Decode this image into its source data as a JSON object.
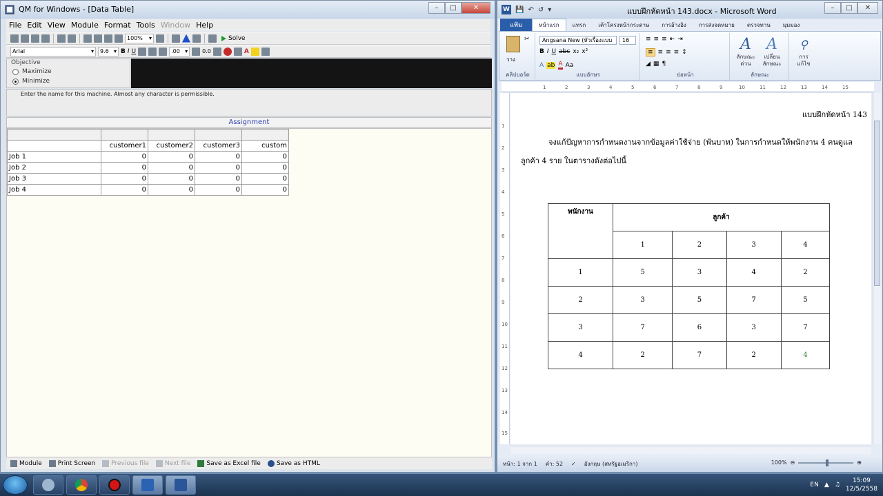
{
  "qm": {
    "title": "QM for Windows - [Data Table]",
    "menu": [
      "File",
      "Edit",
      "View",
      "Module",
      "Format",
      "Tools",
      "Window",
      "Help"
    ],
    "menu_disabled": "Window",
    "toolbar": {
      "zoom": "100%",
      "solve_label": "Solve"
    },
    "format_bar": {
      "font": "Arial",
      "size": "9.6",
      "decimals": ".00",
      "fixed": "0.0"
    },
    "objective": {
      "legend": "Objective",
      "maximize": "Maximize",
      "minimize": "Minimize",
      "selected": "minimize"
    },
    "instruction": "Enter the name for this machine. Almost any character is permissible.",
    "table_title": "Assignment",
    "columns": [
      "customer1",
      "customer2",
      "customer3",
      "custom"
    ],
    "rows": [
      {
        "label": "Job 1",
        "values": [
          "0",
          "0",
          "0",
          "0"
        ]
      },
      {
        "label": "Job 2",
        "values": [
          "0",
          "0",
          "0",
          "0"
        ]
      },
      {
        "label": "Job 3",
        "values": [
          "0",
          "0",
          "0",
          "0"
        ]
      },
      {
        "label": "Job 4",
        "values": [
          "0",
          "0",
          "0",
          "0"
        ]
      }
    ],
    "statusbar": {
      "module": "Module",
      "print": "Print Screen",
      "previous": "Previous file",
      "next": "Next file",
      "excel": "Save as Excel file",
      "html": "Save as HTML"
    }
  },
  "word": {
    "title": "แบบฝึกหัดหน้า 143.docx - Microsoft Word",
    "tabs": [
      "แฟ้ม",
      "หน้าแรก",
      "แทรก",
      "เค้าโครงหน้ากระดาษ",
      "การอ้างอิง",
      "การส่งจดหมาย",
      "ตรวจทาน",
      "มุมมอง"
    ],
    "active_tab": "หน้าแรก",
    "ribbon": {
      "paste": "วาง",
      "font_name": "Angsana New (หัวเรื่องแบบ",
      "font_size": "16",
      "group_clipboard": "คลิปบอร์ด",
      "group_font": "แบบอักษร",
      "group_paragraph": "ย่อหน้า",
      "group_styles": "ลักษณะ",
      "style_quick": "ลักษณะ ด่วน",
      "style_change": "เปลี่ยน ลักษณะ",
      "edit": "การ แก้ไข"
    },
    "ruler_ticks": [
      "1",
      "2",
      "3",
      "4",
      "5",
      "6",
      "7",
      "8",
      "9",
      "10",
      "11",
      "12",
      "13",
      "14",
      "15"
    ],
    "vruler_ticks": [
      "1",
      "2",
      "3",
      "4",
      "5",
      "6",
      "7",
      "8",
      "9",
      "10",
      "11",
      "12",
      "13",
      "14",
      "15"
    ],
    "doc": {
      "heading": "แบบฝึกหัดหน้า 143",
      "paragraph": "จงแก้ปัญหาการกำหนดงานจากข้อมูลค่าใช้จ่าย (พันบาท) ในการกำหนดให้พนักงาน 4 คนดูแลลูกค้า 4 ราย ในตารางดังต่อไปนี้",
      "table": {
        "row_header": "พนักงาน",
        "col_group": "ลูกค้า",
        "col_ids": [
          "1",
          "2",
          "3",
          "4"
        ],
        "rows": [
          {
            "id": "1",
            "values": [
              "5",
              "3",
              "4",
              "2"
            ]
          },
          {
            "id": "2",
            "values": [
              "3",
              "5",
              "7",
              "5"
            ]
          },
          {
            "id": "3",
            "values": [
              "7",
              "6",
              "3",
              "7"
            ]
          },
          {
            "id": "4",
            "values": [
              "2",
              "7",
              "2",
              "4"
            ]
          }
        ]
      }
    },
    "status": {
      "page": "หน้า: 1 จาก 1",
      "words": "คำ: 52",
      "language": "อังกฤษ (สหรัฐอเมริกา)",
      "zoom": "100%"
    }
  },
  "taskbar": {
    "lang": "EN",
    "time": "15:09",
    "date": "12/5/2558"
  }
}
